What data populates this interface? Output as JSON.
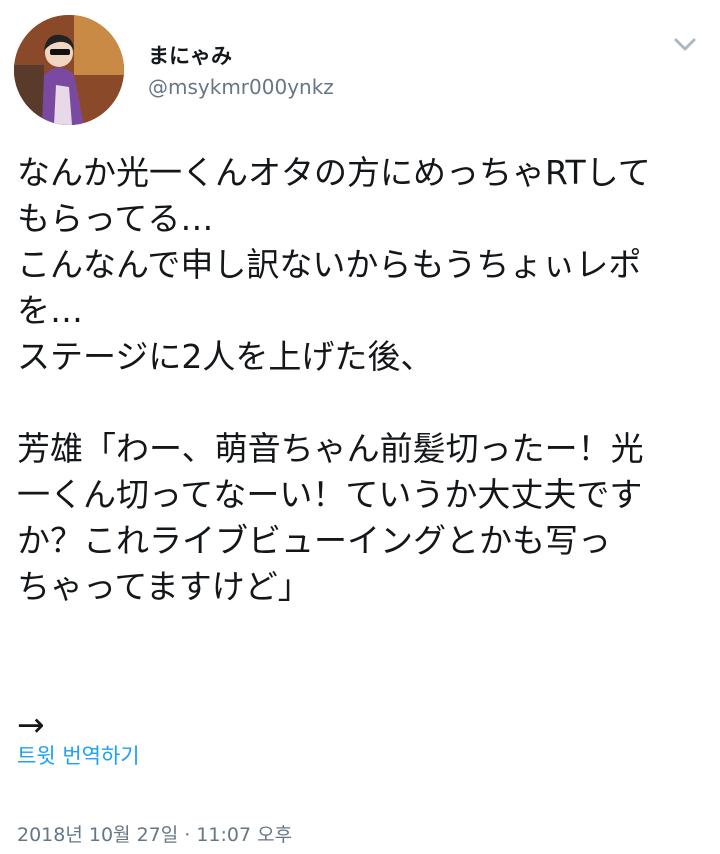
{
  "user": {
    "display_name": "まにゃみ",
    "handle": "@msykmr000ynkz",
    "avatar_icon": "user-avatar"
  },
  "menu_icon": "chevron-down-icon",
  "tweet": {
    "text": "なんか光一くんオタの方にめっちゃRTして\nもらってる…\nこんなんで申し訳ないからもうちょぃレポ\nを…\nステージに2人を上げた後、\n\n芳雄「わー、萌音ちゃん前髪切ったー！光\n一くん切ってなーい！ていうか大丈夫です\nか？これライブビューイングとかも写っ\nちゃってますけど」\n\n\n→"
  },
  "translate_label": "트윗 번역하기",
  "timestamp": "2018년 10월 27일 · 11:07 오후",
  "colors": {
    "link": "#1da1f2",
    "muted": "#657786",
    "text": "#14171a"
  }
}
